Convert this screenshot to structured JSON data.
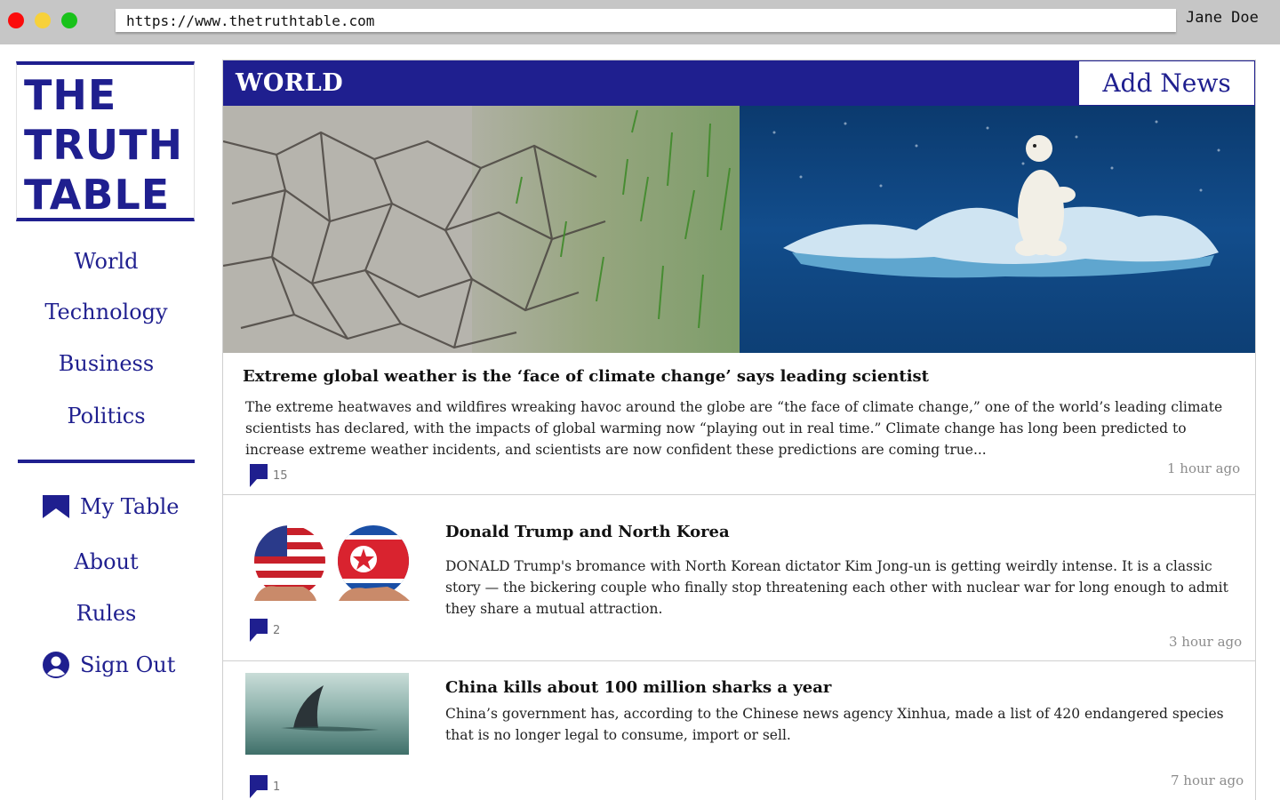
{
  "browser": {
    "url": "https://www.thetruthtable.com",
    "user": "Jane Doe"
  },
  "logo": {
    "lines": [
      "THE",
      "TRUTH",
      "TABLE"
    ]
  },
  "nav": {
    "sections": [
      "World",
      "Technology",
      "Business",
      "Politics"
    ],
    "my_table": "My Table",
    "about": "About",
    "rules": "Rules",
    "sign_out": "Sign Out",
    "icons": {
      "my_table": "bookmark-icon",
      "sign_out": "user-icon"
    }
  },
  "section": {
    "title": "WORLD",
    "add_news_label": "Add News"
  },
  "colors": {
    "brand": "#1f1f8f",
    "chrome": "#c6c6c6"
  },
  "articles": [
    {
      "title": "Extreme global weather is the ‘face of climate change’ says leading scientist",
      "body": "The extreme heatwaves and wildfires wreaking havoc around the globe are “the face of climate change,” one of the world’s leading climate scientists has declared, with the impacts of global warming now “playing out in real time.” Climate change has long been predicted to increase extreme weather incidents, and scientists are now confident these predictions are coming true...",
      "comments": "15",
      "time": "1 hour ago",
      "image": "cracked earth and grass beside polar bear on melting ice"
    },
    {
      "title": "Donald Trump and North Korea",
      "body": "DONALD Trump's bromance with North Korean dictator Kim Jong-un is getting weirdly intense. It is a classic story — the bickering couple who finally stop threatening each other with nuclear war for long enough to admit they share a mutual attraction.",
      "comments": "2",
      "time": "3 hour ago",
      "image": "hands holding US flag ball and North Korea flag ball"
    },
    {
      "title": "China kills about 100 million sharks a year",
      "body": "China’s government has, according to the Chinese news agency Xinhua, made a list of 420 endangered species that is no longer legal to consume, import or sell.",
      "comments": "1",
      "time": "7 hour ago",
      "image": "shark fin above ocean surface"
    }
  ]
}
